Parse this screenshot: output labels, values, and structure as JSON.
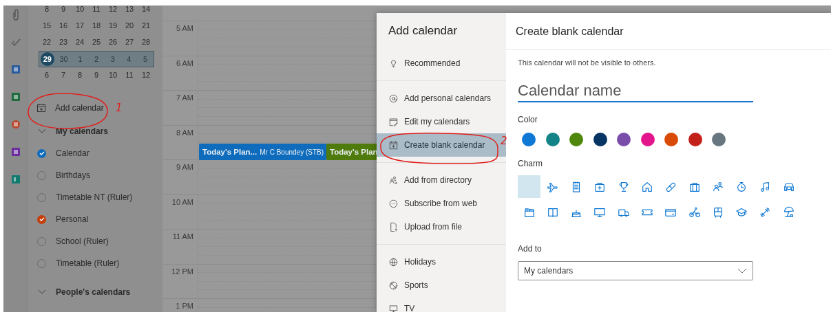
{
  "mini_calendar": {
    "weeks": [
      {
        "selected": false,
        "days": [
          {
            "d": "8",
            "today": false
          },
          {
            "d": "9",
            "today": false
          },
          {
            "d": "10",
            "today": false
          },
          {
            "d": "11",
            "today": false
          },
          {
            "d": "12",
            "today": false
          },
          {
            "d": "13",
            "today": false
          },
          {
            "d": "14",
            "today": false
          }
        ]
      },
      {
        "selected": false,
        "days": [
          {
            "d": "15",
            "today": false
          },
          {
            "d": "16",
            "today": false
          },
          {
            "d": "17",
            "today": false
          },
          {
            "d": "18",
            "today": false
          },
          {
            "d": "19",
            "today": false
          },
          {
            "d": "20",
            "today": false
          },
          {
            "d": "21",
            "today": false
          }
        ]
      },
      {
        "selected": false,
        "days": [
          {
            "d": "22",
            "today": false
          },
          {
            "d": "23",
            "today": false
          },
          {
            "d": "24",
            "today": false
          },
          {
            "d": "25",
            "today": false
          },
          {
            "d": "26",
            "today": false
          },
          {
            "d": "27",
            "today": false
          },
          {
            "d": "28",
            "today": false
          }
        ]
      },
      {
        "selected": true,
        "days": [
          {
            "d": "29",
            "today": true
          },
          {
            "d": "30",
            "today": false
          },
          {
            "d": "1",
            "today": false
          },
          {
            "d": "2",
            "today": false
          },
          {
            "d": "3",
            "today": false
          },
          {
            "d": "4",
            "today": false
          },
          {
            "d": "5",
            "today": false
          }
        ]
      },
      {
        "selected": false,
        "days": [
          {
            "d": "6",
            "today": false
          },
          {
            "d": "7",
            "today": false
          },
          {
            "d": "8",
            "today": false
          },
          {
            "d": "9",
            "today": false
          },
          {
            "d": "10",
            "today": false
          },
          {
            "d": "11",
            "today": false
          },
          {
            "d": "12",
            "today": false
          }
        ]
      }
    ]
  },
  "add_calendar_button": "Add calendar",
  "my_calendars": {
    "title": "My calendars",
    "expanded": true,
    "items": [
      {
        "name": "Calendar",
        "checked": true,
        "color": "#0f6cbd"
      },
      {
        "name": "Birthdays",
        "checked": false
      },
      {
        "name": "Timetable NT (Ruler)",
        "checked": false
      },
      {
        "name": "Personal",
        "checked": true,
        "color": "#c43e0c"
      },
      {
        "name": "School (Ruler)",
        "checked": false
      },
      {
        "name": "Timetable (Ruler)",
        "checked": false
      }
    ]
  },
  "peoples_calendars": {
    "title": "People's calendars",
    "expanded": true
  },
  "time_labels": [
    "5 AM",
    "6 AM",
    "7 AM",
    "8 AM",
    "9 AM",
    "10 AM",
    "11 AM",
    "12 PM",
    "1 PM"
  ],
  "events": [
    {
      "title": "Today's Plan...",
      "organizer": "Mr C Boundey (STB)",
      "color": "#0f6cbd"
    },
    {
      "title": "Today's Plan",
      "color": "#4f7a0c"
    }
  ],
  "dialog": {
    "title": "Add calendar",
    "nav_groups": [
      [
        {
          "label": "Recommended",
          "selected": false
        }
      ],
      [
        {
          "label": "Add personal calendars",
          "selected": false
        },
        {
          "label": "Edit my calendars",
          "selected": false
        },
        {
          "label": "Create blank calendar",
          "selected": true
        }
      ],
      [
        {
          "label": "Add from directory",
          "selected": false
        },
        {
          "label": "Subscribe from web",
          "selected": false
        },
        {
          "label": "Upload from file",
          "selected": false
        }
      ],
      [
        {
          "label": "Holidays",
          "selected": false
        },
        {
          "label": "Sports",
          "selected": false
        },
        {
          "label": "TV",
          "selected": false
        }
      ]
    ],
    "pane": {
      "title": "Create blank calendar",
      "note": "This calendar will not be visible to others.",
      "name_field": {
        "placeholder": "Calendar name"
      },
      "color_label": "Color",
      "colors": [
        {
          "color": "#0f78d4"
        },
        {
          "color": "#138387"
        },
        {
          "color": "#4f860c"
        },
        {
          "color": "#063564"
        },
        {
          "color": "#7b4dab"
        },
        {
          "color": "#e2158c"
        },
        {
          "color": "#d84a06"
        },
        {
          "color": "#c4201a"
        },
        {
          "color": "#68767f"
        }
      ],
      "charm_label": "Charm",
      "charms": [
        {
          "selected": true
        },
        {
          "selected": false
        },
        {
          "selected": false
        },
        {
          "selected": false
        },
        {
          "selected": false
        },
        {
          "selected": false
        },
        {
          "selected": false
        },
        {
          "selected": false
        },
        {
          "selected": false
        },
        {
          "selected": false
        },
        {
          "selected": false
        },
        {
          "selected": false
        },
        {
          "selected": false
        },
        {
          "selected": false
        },
        {
          "selected": false
        },
        {
          "selected": false
        },
        {
          "selected": false
        },
        {
          "selected": false
        },
        {
          "selected": false
        },
        {
          "selected": false
        },
        {
          "selected": false
        },
        {
          "selected": false
        },
        {
          "selected": false
        },
        {
          "selected": false
        }
      ],
      "add_to_label": "Add to",
      "add_to_dropdown": {
        "value": "My calendars"
      }
    }
  },
  "annotations": [
    {
      "label": "1"
    },
    {
      "label": "2"
    }
  ]
}
